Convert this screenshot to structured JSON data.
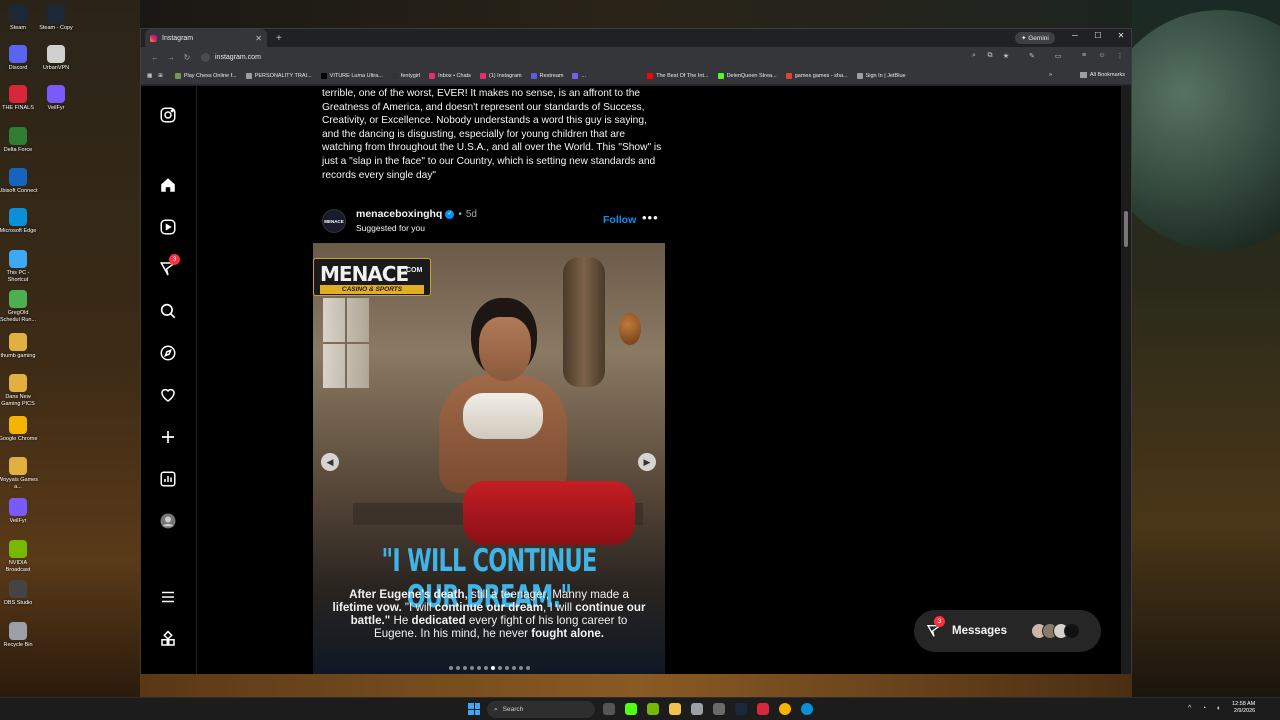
{
  "desktop": {
    "icons": [
      {
        "label": "Steam",
        "color": "#1b2838"
      },
      {
        "label": "Steam - Copy",
        "color": "#1b2838"
      },
      {
        "label": "Discord",
        "color": "#5865f2"
      },
      {
        "label": "UrbanVPN",
        "color": "#d0d0d0"
      },
      {
        "label": "THE FINALS",
        "color": "#d8263a"
      },
      {
        "label": "VeilFyr",
        "color": "#7a5af8"
      },
      {
        "label": "Delta Force",
        "color": "#2e7d32"
      },
      {
        "label": "Ubisoft Connect",
        "color": "#1565c0"
      },
      {
        "label": "Microsoft Edge",
        "color": "#0b8fd6"
      },
      {
        "label": "This PC - Shortcut",
        "color": "#3fa8f4"
      },
      {
        "label": "GregOld Schedul Run...",
        "color": "#4caf50"
      },
      {
        "label": "thumb gaming",
        "color": "#e0b040"
      },
      {
        "label": "Dans New Gaming PICS",
        "color": "#e0b040"
      },
      {
        "label": "Google Chrome",
        "color": "#f4b400"
      },
      {
        "label": "Woyyais Games a...",
        "color": "#e0b040"
      },
      {
        "label": "VeilFyr",
        "color": "#7a5af8"
      },
      {
        "label": "NVIDIA Broadcast",
        "color": "#76b900"
      },
      {
        "label": "OBS Studio",
        "color": "#444444"
      },
      {
        "label": "Recycle Bin",
        "color": "#9aa0a6"
      }
    ]
  },
  "browser": {
    "tab_title": "Instagram",
    "gemini_label": "✦ Gemini",
    "url": "instagram.com",
    "bookmarks": [
      {
        "label": "Play Chess Online f...",
        "color": "#769656"
      },
      {
        "label": "PERSONALITY TRAI...",
        "color": "#9aa0a6"
      },
      {
        "label": "VITURE Luma Ultra...",
        "color": "#000000"
      },
      {
        "label": "fentygirl",
        "color": "#333333"
      },
      {
        "label": "Inbox • Chats",
        "color": "#e1306c"
      },
      {
        "label": "(1) Instagram",
        "color": "#e1306c"
      },
      {
        "label": "Restream",
        "color": "#5b5ce2"
      },
      {
        "label": "...",
        "color": "#7a5af8"
      },
      {
        "label": "The Best Of The Int...",
        "color": "#ff0000"
      },
      {
        "label": "DelenQueen Strea...",
        "color": "#53fc18"
      },
      {
        "label": "games games - sha...",
        "color": "#db4437"
      },
      {
        "label": "Sign In | JetBlue",
        "color": "#9aa0a6"
      }
    ],
    "all_bookmarks": "All Bookmarks"
  },
  "instagram": {
    "notifications_badge": "3",
    "caption": "terrible, one of the worst, EVER! It makes no sense, is an affront to the Greatness of America, and doesn't represent our standards of Success, Creativity, or Excellence. Nobody understands a word this guy is saying, and the dancing is disgusting, especially for young children that are watching from throughout the U.S.A., and all over the World. This \"Show\" is just a \"slap in the face\" to our Country, which is setting new standards and records every single day\"",
    "post": {
      "avatar_text": "MENACE",
      "username": "menaceboxinghq",
      "separator": "•",
      "time": "5d",
      "subtitle": "Suggested for you",
      "follow_label": "Follow",
      "more_label": "•••",
      "logo_main": "MENACE",
      "logo_com": ".COM",
      "logo_sub": "CASINO & SPORTS",
      "quote": "\"I WILL CONTINUE OUR DREAM.\"",
      "story": [
        {
          "t": "After Eugene's death,",
          "b": true
        },
        {
          "t": " still a teenager, Manny made a ",
          "b": false
        },
        {
          "t": "lifetime vow.",
          "b": true
        },
        {
          "t": " \"I will ",
          "b": false
        },
        {
          "t": "continue our dream",
          "b": true
        },
        {
          "t": ", I will ",
          "b": false
        },
        {
          "t": "continue our battle.\"",
          "b": true
        },
        {
          "t": " He ",
          "b": false
        },
        {
          "t": "dedicated",
          "b": true
        },
        {
          "t": " every fight of his long career to Eugene. In his mind, he never ",
          "b": false
        },
        {
          "t": "fought alone.",
          "b": true
        }
      ],
      "slide_count": 12,
      "active_slide": 7
    },
    "messages": {
      "label": "Messages",
      "badge": "3"
    }
  },
  "taskbar": {
    "search_label": "Search",
    "time": "12:58 AM",
    "date": "2/9/2026"
  },
  "colors": {
    "accent": "#0095f6",
    "badge": "#ff3040",
    "quote": "#3fb4e8"
  }
}
